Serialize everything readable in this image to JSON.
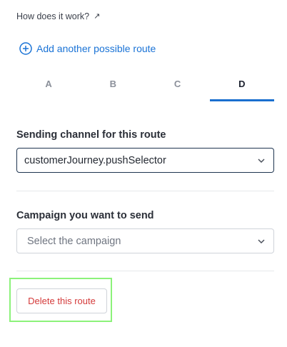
{
  "help": {
    "link_label": "How does it work?",
    "link_icon": "external-arrow-icon"
  },
  "add_route": {
    "label": "Add another possible route",
    "icon": "plus-circle-icon",
    "color": "#1a73d6"
  },
  "tabs": [
    {
      "label": "A",
      "active": false
    },
    {
      "label": "B",
      "active": false
    },
    {
      "label": "C",
      "active": false
    },
    {
      "label": "D",
      "active": true
    }
  ],
  "channel": {
    "label": "Sending channel for this route",
    "value": "customerJourney.pushSelector"
  },
  "campaign": {
    "label": "Campaign you want to send",
    "placeholder": "Select the campaign"
  },
  "delete": {
    "label": "Delete this route",
    "color": "#d43a3a",
    "highlight_color": "#8cf27a"
  },
  "colors": {
    "accent": "#1a6fcf",
    "border": "#cfd3d9"
  }
}
